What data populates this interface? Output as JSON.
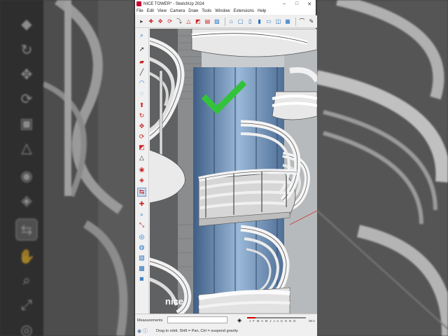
{
  "window": {
    "title": "NICE TOWER* - SketchUp 2024",
    "controls": [
      "–",
      "□",
      "✕"
    ]
  },
  "menu": [
    "File",
    "Edit",
    "View",
    "Camera",
    "Draw",
    "Tools",
    "Window",
    "Extensions",
    "Help"
  ],
  "toolbar_top": [
    "select-icon",
    "orbit-icon",
    "pan-icon",
    "rotate-icon",
    "move-icon",
    "warning-icon",
    "scale-icon",
    "offset-icon",
    "paint-icon",
    "front-view-icon",
    "top-view-icon",
    "right-view-icon",
    "back-view-icon",
    "left-view-icon",
    "iso-view-icon",
    "bottom-view-icon",
    "arc-icon",
    "pencil-icon"
  ],
  "toolbar_left": [
    "zoom-icon",
    "select-arrow-icon",
    "eraser-icon",
    "line-icon",
    "arc-tool-icon",
    "circle-icon",
    "push-pull-icon",
    "follow-me-icon",
    "move-tool-icon",
    "rotate-tool-icon",
    "scale-tool-icon",
    "tape-icon",
    "protractor-icon",
    "dimension-icon",
    "text-icon",
    "axes-icon",
    "section-plane-icon",
    "orbit-tool-icon",
    "pan-tool-icon",
    "zoom-tool-icon",
    "zoom-extents-icon",
    "walk-icon",
    "look-around-icon",
    "position-camera-icon",
    "styles-icon",
    "components-icon"
  ],
  "active_left_tool": "section-plane-icon",
  "viewport": {
    "watermark": "nice",
    "checkmark_color": "#33c33a"
  },
  "status": {
    "measurements_label": "Measurements",
    "measurements_value": "",
    "months": "J F M A M J J A S O N D",
    "time": "06:4",
    "hint": "Drag to orbit. Shift = Pan, Ctrl = suspend gravity."
  },
  "colors": {
    "accent_blue": "#1f6fbf",
    "checkmark": "#33c33a",
    "brand": "#c5002e"
  }
}
